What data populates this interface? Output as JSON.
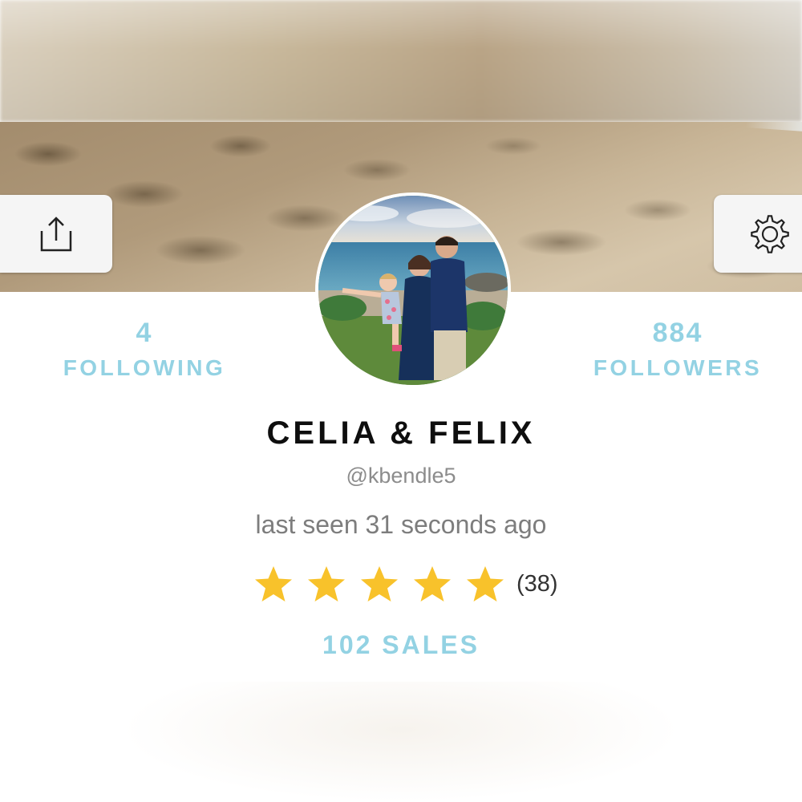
{
  "profile": {
    "display_name": "CELIA & FELIX",
    "handle": "@kbendle5",
    "last_seen": "last seen 31 seconds ago",
    "rating_stars": 5,
    "rating_count": "(38)",
    "sales": "102 SALES"
  },
  "stats": {
    "following_count": "4",
    "following_label": "FOLLOWING",
    "followers_count": "884",
    "followers_label": "FOLLOWERS"
  },
  "icons": {
    "share": "share-icon",
    "settings": "gear-icon",
    "star": "star-icon"
  },
  "colors": {
    "accent": "#93d2e3",
    "star": "#f8c22b",
    "name": "#0e0e0e",
    "muted": "#8c8c8c"
  }
}
